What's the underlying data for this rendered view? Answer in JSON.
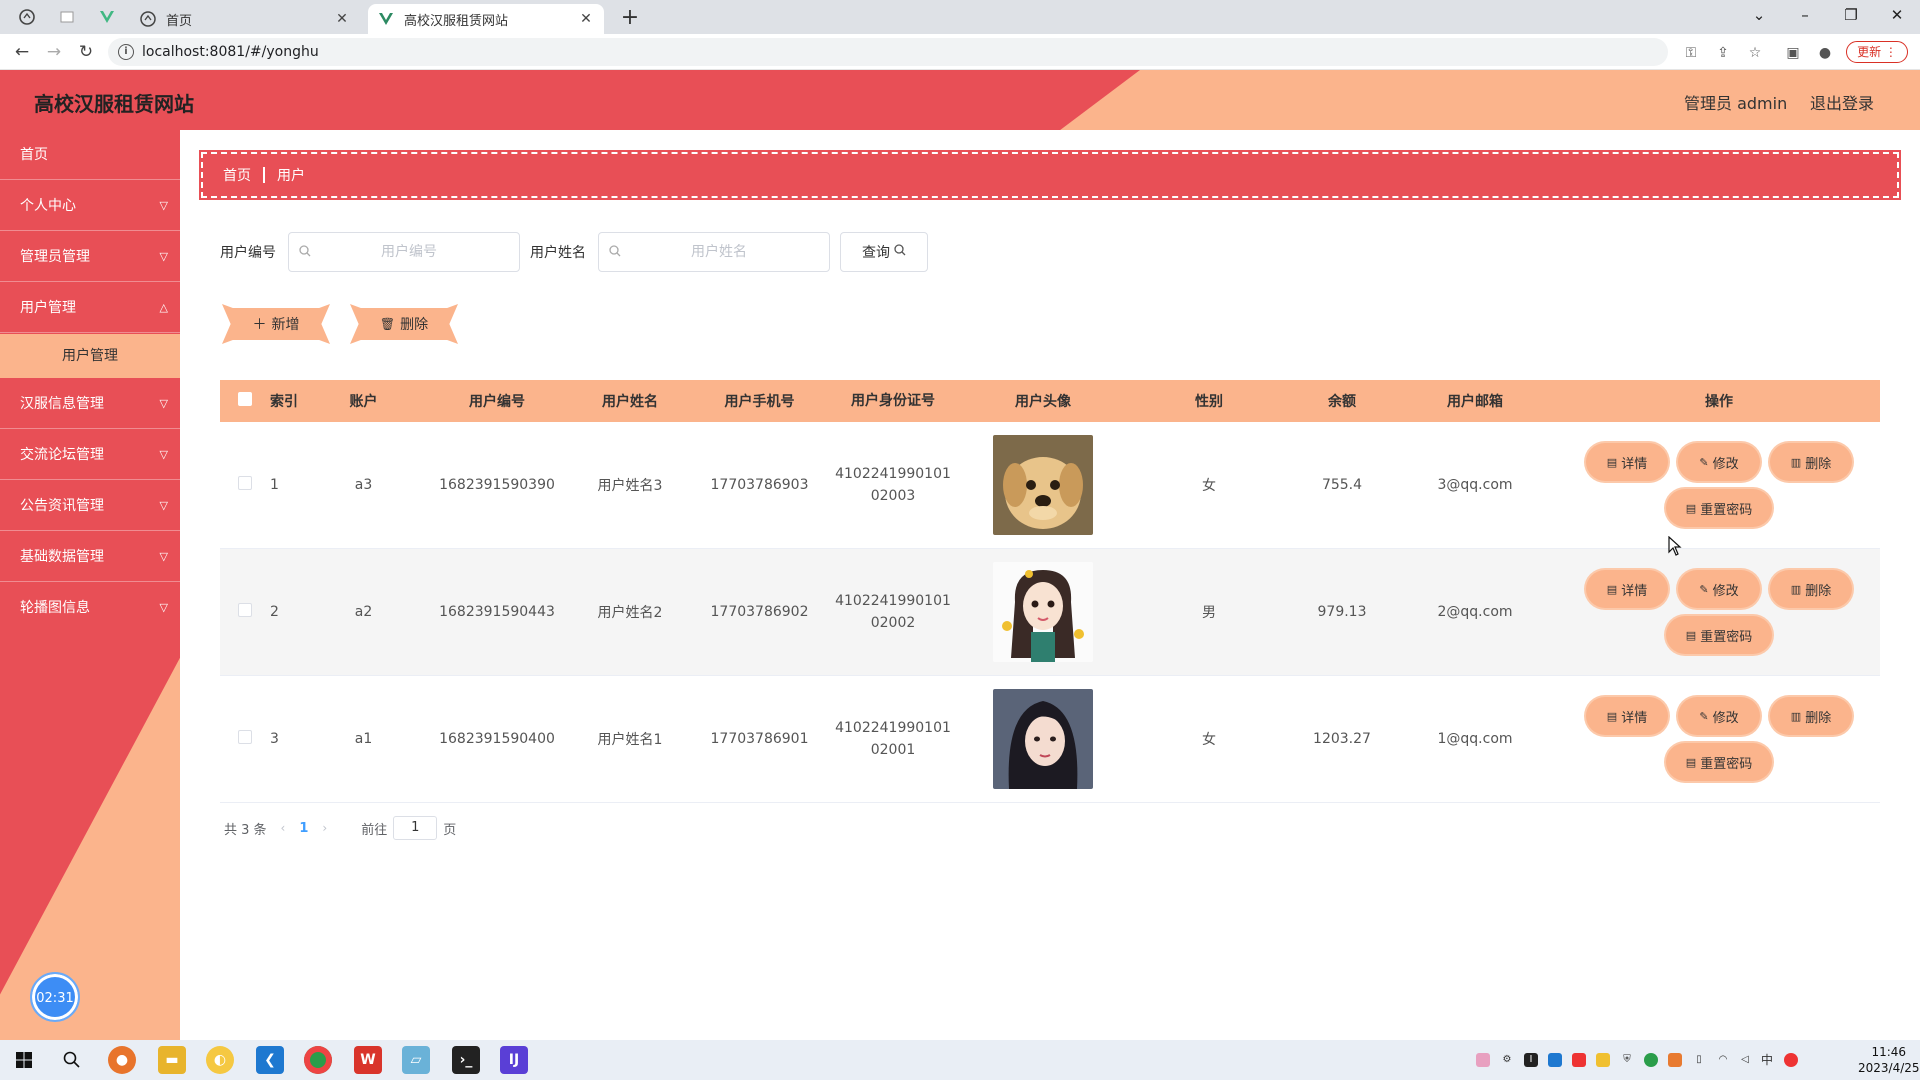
{
  "browser": {
    "tabs": [
      {
        "label": "首页",
        "active": false
      },
      {
        "label": "高校汉服租赁网站",
        "active": true
      }
    ],
    "new_tab_symbol": "+",
    "url": "localhost:8081/#/yonghu",
    "update_label": "更新"
  },
  "app": {
    "title": "高校汉服租赁网站",
    "admin_label": "管理员 admin",
    "logout_label": "退出登录"
  },
  "sidebar": {
    "items": [
      {
        "label": "首页",
        "expandable": false
      },
      {
        "label": "个人中心",
        "expandable": true
      },
      {
        "label": "管理员管理",
        "expandable": true
      },
      {
        "label": "用户管理",
        "expandable": true
      },
      {
        "label": "汉服信息管理",
        "expandable": true
      },
      {
        "label": "交流论坛管理",
        "expandable": true
      },
      {
        "label": "公告资讯管理",
        "expandable": true
      },
      {
        "label": "基础数据管理",
        "expandable": true
      },
      {
        "label": "轮播图信息",
        "expandable": true
      }
    ],
    "active_sub": "用户管理",
    "timer": "02:31"
  },
  "breadcrumb": {
    "home": "首页",
    "current": "用户"
  },
  "search": {
    "no_label": "用户编号",
    "no_placeholder": "用户编号",
    "name_label": "用户姓名",
    "name_placeholder": "用户姓名",
    "query_label": "查询"
  },
  "actions": {
    "add_label": "新增",
    "delete_label": "删除"
  },
  "table": {
    "headers": {
      "index": "索引",
      "account": "账户",
      "no": "用户编号",
      "name": "用户姓名",
      "phone": "用户手机号",
      "idcard": "用户身份证号",
      "avatar": "用户头像",
      "gender": "性别",
      "balance": "余额",
      "email": "用户邮箱",
      "ops": "操作"
    },
    "rows": [
      {
        "index": "1",
        "account": "a3",
        "no": "1682391590390",
        "name": "用户姓名3",
        "phone": "17703786903",
        "idcard1": "4102241990101",
        "idcard2": "02003",
        "gender": "女",
        "balance": "755.4",
        "email": "3@qq.com",
        "avatar": "puppy"
      },
      {
        "index": "2",
        "account": "a2",
        "no": "1682391590443",
        "name": "用户姓名2",
        "phone": "17703786902",
        "idcard1": "4102241990101",
        "idcard2": "02002",
        "gender": "男",
        "balance": "979.13",
        "email": "2@qq.com",
        "avatar": "cartoon-girl"
      },
      {
        "index": "3",
        "account": "a1",
        "no": "1682391590400",
        "name": "用户姓名1",
        "phone": "17703786901",
        "idcard1": "4102241990101",
        "idcard2": "02001",
        "gender": "女",
        "balance": "1203.27",
        "email": "1@qq.com",
        "avatar": "girl-photo"
      }
    ],
    "ops": {
      "detail": "详情",
      "edit": "修改",
      "delete": "删除",
      "reset": "重置密码"
    }
  },
  "pager": {
    "total": "共 3 条",
    "page": "1",
    "goto_prefix": "前往",
    "goto_value": "1",
    "goto_suffix": "页"
  },
  "taskbar": {
    "time": "11:46",
    "date": "2023/4/25",
    "ime": "中"
  }
}
